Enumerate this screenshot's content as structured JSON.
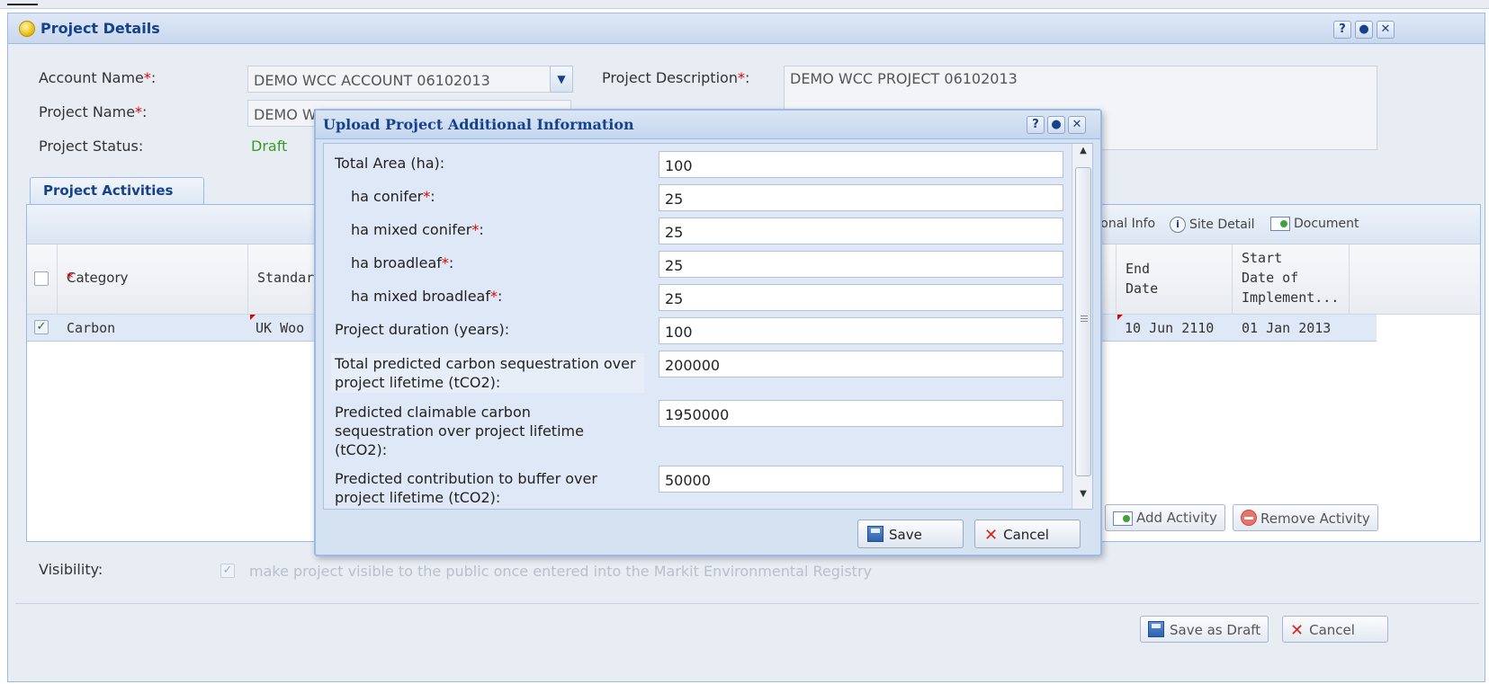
{
  "panel": {
    "title": "Project Details",
    "tools": [
      "?",
      "●",
      "✕"
    ]
  },
  "form": {
    "account_name_label": "Account Name",
    "account_name_value": "DEMO WCC ACCOUNT 06102013",
    "project_name_label": "Project Name",
    "project_name_value": "DEMO W",
    "project_status_label": "Project Status:",
    "project_status_value": "Draft",
    "project_description_label": "Project Description",
    "project_description_value": "DEMO WCC PROJECT 06102013",
    "required_mark": "*",
    "colon": ":"
  },
  "tab": {
    "label": "Project Activities"
  },
  "toolbar": {
    "additional_info_label": "itional Info",
    "site_detail_label": "Site Detail",
    "document_label": "Document"
  },
  "grid": {
    "columns": {
      "category": "Category",
      "standard": "Standar",
      "end_date_line1": "End",
      "end_date_line2": "Date",
      "start_line1": "Start",
      "start_line2": "Date of",
      "start_line3": "Implement..."
    },
    "rows": [
      {
        "category": "Carbon",
        "standard": "UK Woo",
        "end_date": "10 Jun 2110",
        "start_date": "01 Jan 2013"
      }
    ]
  },
  "actions": {
    "add_activity": "Add Activity",
    "remove_activity": "Remove Activity"
  },
  "visibility": {
    "label": "Visibility:",
    "checkbox_text": "make project visible to the public once entered into the Markit Environmental Registry"
  },
  "footer": {
    "save_draft": "Save as Draft",
    "cancel": "Cancel"
  },
  "modal": {
    "title": "Upload Project Additional Information",
    "tools": [
      "?",
      "●",
      "✕"
    ],
    "fields": [
      {
        "label": "Total Area (ha):",
        "value": "100",
        "required": false
      },
      {
        "label": "ha conifer",
        "value": "25",
        "required": true
      },
      {
        "label": "ha mixed conifer",
        "value": "25",
        "required": true
      },
      {
        "label": "ha broadleaf",
        "value": "25",
        "required": true
      },
      {
        "label": "ha mixed broadleaf",
        "value": "25",
        "required": true
      },
      {
        "label": "Project duration (years):",
        "value": "100",
        "required": false
      },
      {
        "label": "Total predicted carbon sequestration over project lifetime (tCO2):",
        "value": "200000",
        "required": false
      },
      {
        "label": "Predicted claimable carbon sequestration over project lifetime (tCO2):",
        "value": "1950000",
        "required": false
      },
      {
        "label": "Predicted contribution to buffer over project lifetime (tCO2):",
        "value": "50000",
        "required": false
      }
    ],
    "save_label": "Save",
    "cancel_label": "Cancel"
  },
  "colors": {
    "accent": "#15428b",
    "border": "#99bbe8",
    "required": "#e00000",
    "status_draft": "#3a9a25"
  }
}
